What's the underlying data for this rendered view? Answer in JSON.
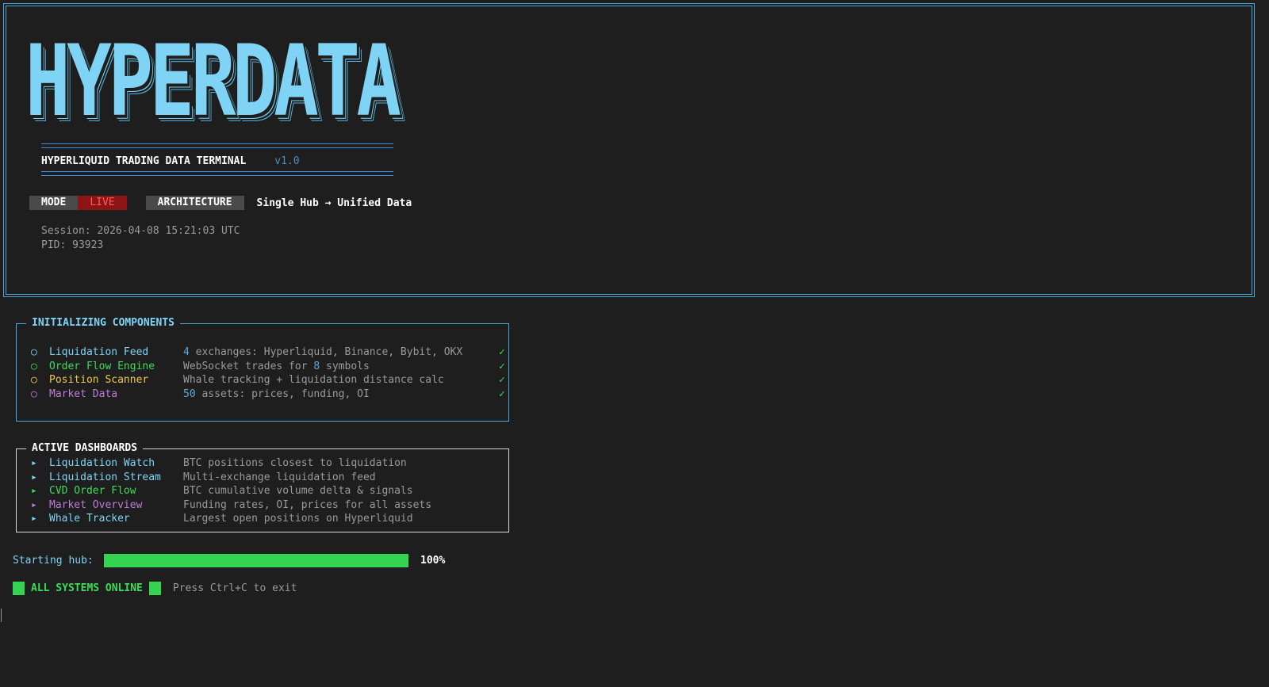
{
  "banner": {
    "logo": "HYPERDATA",
    "title": "HYPERLIQUID TRADING DATA TERMINAL",
    "version": "v1.0",
    "mode_label": "MODE",
    "mode_value": "LIVE",
    "architecture_label": "ARCHITECTURE",
    "architecture_value": "Single Hub → Unified Data",
    "session": "Session: 2026-04-08 15:21:03 UTC",
    "pid": "PID: 93923"
  },
  "components": {
    "title": "INITIALIZING COMPONENTS",
    "items": [
      {
        "icon": "circle-icon",
        "name": "Liquidation Feed",
        "desc_num": "4",
        "desc": " exchanges: Hyperliquid, Binance, Bybit, OKX",
        "status": "✓",
        "color": "#7fd4f6"
      },
      {
        "icon": "circle-icon",
        "name": "Order Flow Engine",
        "desc_pre": "WebSocket trades for ",
        "desc_num": "8",
        "desc": " symbols",
        "status": "✓",
        "color": "#3ddc5a"
      },
      {
        "icon": "circle-icon",
        "name": "Position Scanner",
        "desc": "Whale tracking + liquidation distance calc",
        "status": "✓",
        "color": "#f0c94a"
      },
      {
        "icon": "circle-icon",
        "name": "Market Data",
        "desc_num": "50",
        "desc": " assets: prices, funding, OI",
        "status": "✓",
        "color": "#c07ad8"
      }
    ]
  },
  "dashboards": {
    "title": "ACTIVE DASHBOARDS",
    "items": [
      {
        "icon": "triangle-right-icon",
        "name": "Liquidation Watch",
        "desc": "BTC positions closest to liquidation",
        "color": "#7fd4f6"
      },
      {
        "icon": "triangle-right-icon",
        "name": "Liquidation Stream",
        "desc": "Multi-exchange liquidation feed",
        "color": "#7fd4f6"
      },
      {
        "icon": "triangle-right-icon",
        "name": "CVD Order Flow",
        "desc": "BTC cumulative volume delta & signals",
        "color": "#3ddc5a"
      },
      {
        "icon": "triangle-right-icon",
        "name": "Market Overview",
        "desc": "Funding rates, OI, prices for all assets",
        "color": "#c07ad8"
      },
      {
        "icon": "triangle-right-icon",
        "name": "Whale Tracker",
        "desc": "Largest open positions on Hyperliquid",
        "color": "#7fd4f6"
      }
    ]
  },
  "progress": {
    "label": "Starting hub:",
    "value": 1.0,
    "percent_text": "100%"
  },
  "status": {
    "text": "ALL SYSTEMS ONLINE",
    "hint": "Press Ctrl+C to exit"
  }
}
